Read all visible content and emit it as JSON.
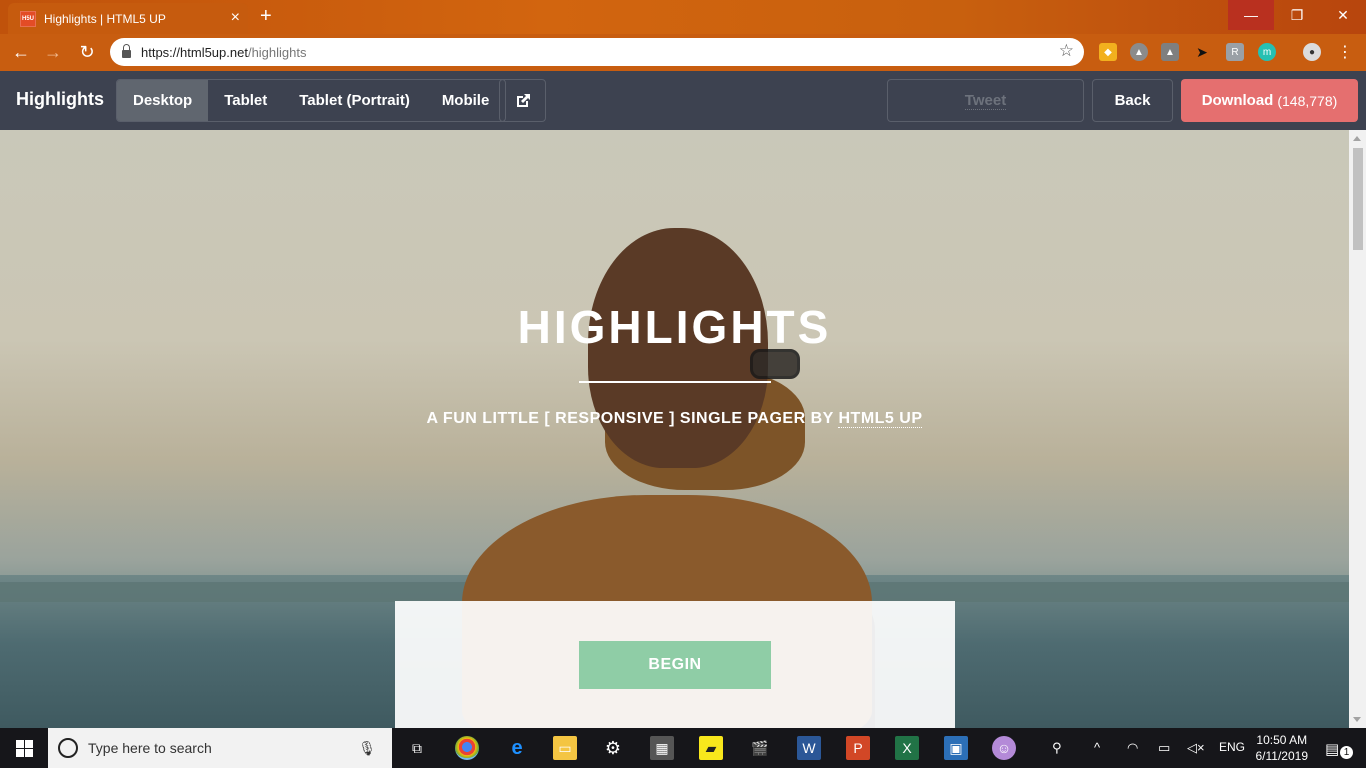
{
  "browser": {
    "tab_title": "Highlights | HTML5 UP",
    "favicon_text": "H5U",
    "url_host": "https://html5up.net",
    "url_path": "/highlights"
  },
  "site_header": {
    "title": "Highlights",
    "views": [
      "Desktop",
      "Tablet",
      "Tablet (Portrait)",
      "Mobile"
    ],
    "active_view": "Desktop",
    "tweet_label": "Tweet",
    "back_label": "Back",
    "download_label": "Download",
    "download_count": "(148,778)"
  },
  "hero": {
    "title": "HIGHLIGHTS",
    "subtitle_prefix": "A FUN LITTLE [ RESPONSIVE ] SINGLE PAGER BY ",
    "subtitle_link": "HTML5 UP",
    "button_label": "BEGIN"
  },
  "taskbar": {
    "search_placeholder": "Type here to search",
    "language": "ENG",
    "time": "10:50 AM",
    "date": "6/11/2019",
    "notification_count": "1"
  },
  "colors": {
    "site_header_bg": "#3d4250",
    "download_bg": "#e56f6f",
    "begin_bg": "#8fcda6",
    "browser_accent": "#c85d10"
  }
}
